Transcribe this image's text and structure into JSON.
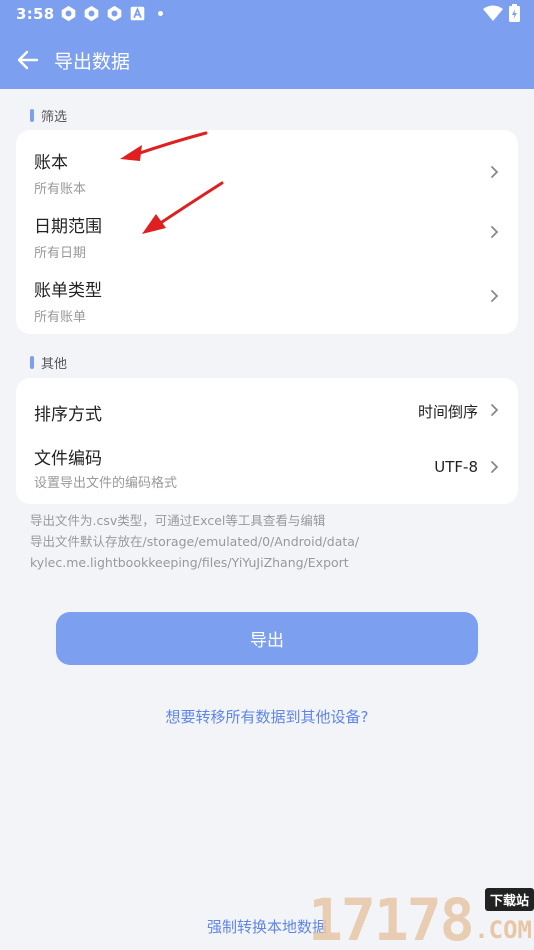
{
  "status_bar": {
    "time": "3:58",
    "left_icons": [
      "app-notification-icon",
      "app-notification-icon",
      "app-notification-icon",
      "a-box-icon",
      "dot-icon"
    ],
    "right_icons": [
      "wifi-icon",
      "battery-charging-icon"
    ]
  },
  "header": {
    "title": "导出数据",
    "back_icon": "arrow-left-icon"
  },
  "filter_section": {
    "label": "筛选",
    "items": [
      {
        "title": "账本",
        "subtitle": "所有账本"
      },
      {
        "title": "日期范围",
        "subtitle": "所有日期"
      },
      {
        "title": "账单类型",
        "subtitle": "所有账单"
      }
    ]
  },
  "other_section": {
    "label": "其他",
    "items": [
      {
        "title": "排序方式",
        "value": "时间倒序"
      },
      {
        "title": "文件编码",
        "subtitle": "设置导出文件的编码格式",
        "value": "UTF-8"
      }
    ]
  },
  "notes": {
    "line1": "导出文件为.csv类型，可通过Excel等工具查看与编辑",
    "line2": "导出文件默认存放在/storage/emulated/0/Android/data/",
    "line3": "kylec.me.lightbookkeeping/files/YiYuJiZhang/Export"
  },
  "actions": {
    "export_label": "导出",
    "transfer_label": "想要转移所有数据到其他设备?",
    "force_convert_label": "强制转换本地数据"
  },
  "watermark": {
    "digits": "17178",
    "badge": "下载站",
    "com": ".COM"
  },
  "colors": {
    "accent": "#7c9ff0",
    "link": "#5f86e8",
    "background": "#f3f4f7",
    "annotation": "#e02020"
  }
}
